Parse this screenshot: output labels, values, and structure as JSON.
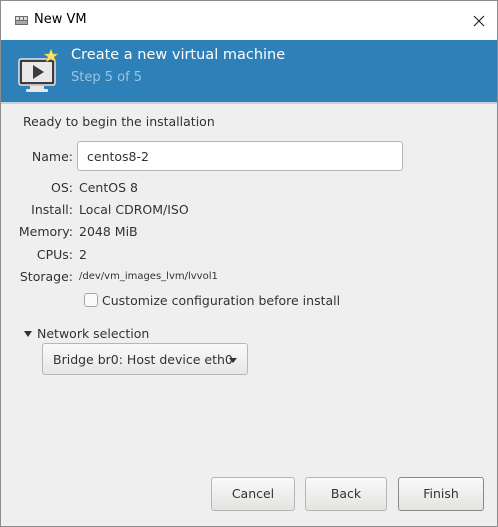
{
  "window": {
    "title": "New VM",
    "close_icon": "close-icon"
  },
  "banner": {
    "title": "Create a new virtual machine",
    "step": "Step 5 of 5",
    "icon": "new-vm-icon",
    "color": "#2d80b8"
  },
  "summary": {
    "heading": "Ready to begin the installation",
    "name_label": "Name:",
    "name_value": "centos8-2",
    "os_label": "OS:",
    "os_value": "CentOS 8",
    "install_label": "Install:",
    "install_value": "Local CDROM/ISO",
    "memory_label": "Memory:",
    "memory_value": "2048 MiB",
    "cpus_label": "CPUs:",
    "cpus_value": "2",
    "storage_label": "Storage:",
    "storage_value": "/dev/vm_images_lvm/lvvol1",
    "customize_label": "Customize configuration before install",
    "customize_checked": false
  },
  "network": {
    "expander_label": "Network selection",
    "selected": "Bridge br0: Host device eth0"
  },
  "buttons": {
    "cancel": "Cancel",
    "back": "Back",
    "finish": "Finish"
  }
}
